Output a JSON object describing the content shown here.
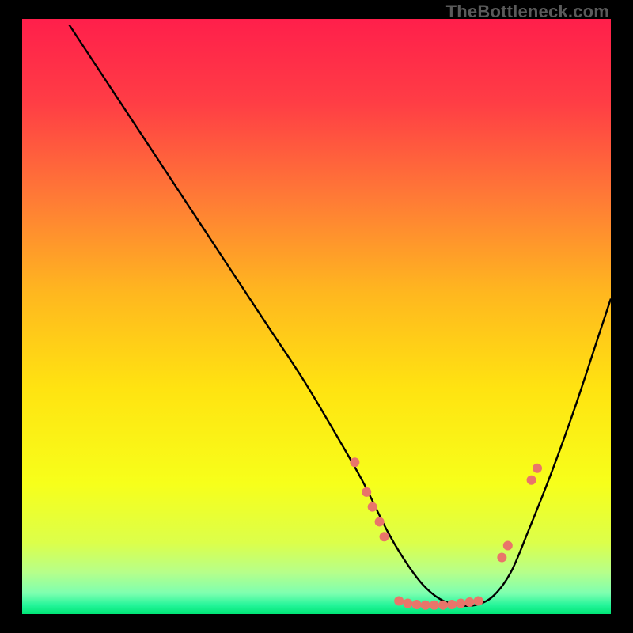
{
  "watermark": "TheBottleneck.com",
  "chart_data": {
    "type": "line",
    "title": "",
    "xlabel": "",
    "ylabel": "",
    "xlim": [
      0,
      100
    ],
    "ylim": [
      0,
      100
    ],
    "gradient_stops": [
      {
        "offset": 0.0,
        "color": "#ff1f4b"
      },
      {
        "offset": 0.14,
        "color": "#ff3d45"
      },
      {
        "offset": 0.3,
        "color": "#ff7a36"
      },
      {
        "offset": 0.46,
        "color": "#ffb71f"
      },
      {
        "offset": 0.62,
        "color": "#ffe311"
      },
      {
        "offset": 0.78,
        "color": "#f7ff1a"
      },
      {
        "offset": 0.88,
        "color": "#dcff4a"
      },
      {
        "offset": 0.93,
        "color": "#b6ff8a"
      },
      {
        "offset": 0.965,
        "color": "#7effb0"
      },
      {
        "offset": 0.985,
        "color": "#25f59a"
      },
      {
        "offset": 1.0,
        "color": "#00e676"
      }
    ],
    "series": [
      {
        "name": "bottleneck-curve",
        "color": "#000000",
        "x": [
          8,
          12,
          18,
          24,
          30,
          36,
          42,
          48,
          54,
          58,
          62,
          65,
          68,
          71,
          74,
          77,
          80,
          83,
          86,
          90,
          94,
          98,
          100
        ],
        "y": [
          99,
          93,
          84,
          75,
          66,
          57,
          48,
          39,
          29,
          22,
          14,
          9,
          5,
          2.5,
          1.5,
          1.5,
          3,
          7,
          14,
          24,
          35,
          47,
          53
        ]
      }
    ],
    "markers": {
      "name": "highlight-points",
      "color": "#e9756a",
      "radius": 6,
      "points": [
        {
          "x": 56.5,
          "y": 25.5
        },
        {
          "x": 58.5,
          "y": 20.5
        },
        {
          "x": 59.5,
          "y": 18.0
        },
        {
          "x": 60.7,
          "y": 15.5
        },
        {
          "x": 61.5,
          "y": 13.0
        },
        {
          "x": 64.0,
          "y": 2.2
        },
        {
          "x": 65.5,
          "y": 1.8
        },
        {
          "x": 67.0,
          "y": 1.6
        },
        {
          "x": 68.5,
          "y": 1.5
        },
        {
          "x": 70.0,
          "y": 1.5
        },
        {
          "x": 71.5,
          "y": 1.5
        },
        {
          "x": 73.0,
          "y": 1.6
        },
        {
          "x": 74.5,
          "y": 1.8
        },
        {
          "x": 76.0,
          "y": 2.0
        },
        {
          "x": 77.5,
          "y": 2.2
        },
        {
          "x": 81.5,
          "y": 9.5
        },
        {
          "x": 82.5,
          "y": 11.5
        },
        {
          "x": 86.5,
          "y": 22.5
        },
        {
          "x": 87.5,
          "y": 24.5
        }
      ]
    }
  }
}
